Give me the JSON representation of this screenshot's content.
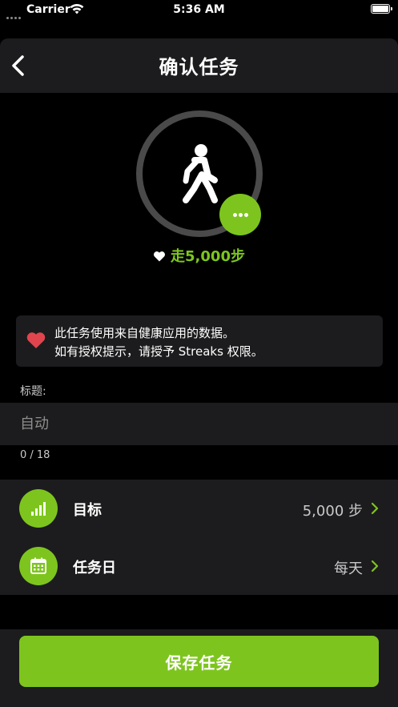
{
  "status_bar": {
    "carrier": "Carrier",
    "time": "5:36 AM"
  },
  "nav": {
    "title": "确认任务",
    "back_icon": "chevron-left-icon"
  },
  "task": {
    "icon": "walking-person-icon",
    "more_icon": "ellipsis-icon",
    "health_label": "走5,000步"
  },
  "notice": {
    "line1": "此任务使用来自健康应用的数据。",
    "line2": "如有授权提示，请授予 Streaks 权限。"
  },
  "title_field": {
    "label": "标题:",
    "placeholder": "自动",
    "value": "",
    "counter": "0 / 18"
  },
  "settings": [
    {
      "icon": "bar-chart-icon",
      "label": "目标",
      "value": "5,000 步"
    },
    {
      "icon": "calendar-icon",
      "label": "任务日",
      "value": "每天"
    }
  ],
  "save_button": {
    "label": "保存任务"
  },
  "colors": {
    "accent": "#7dc51e",
    "background": "#000000",
    "surface": "#1c1c1e",
    "heart_red": "#e0454e"
  }
}
